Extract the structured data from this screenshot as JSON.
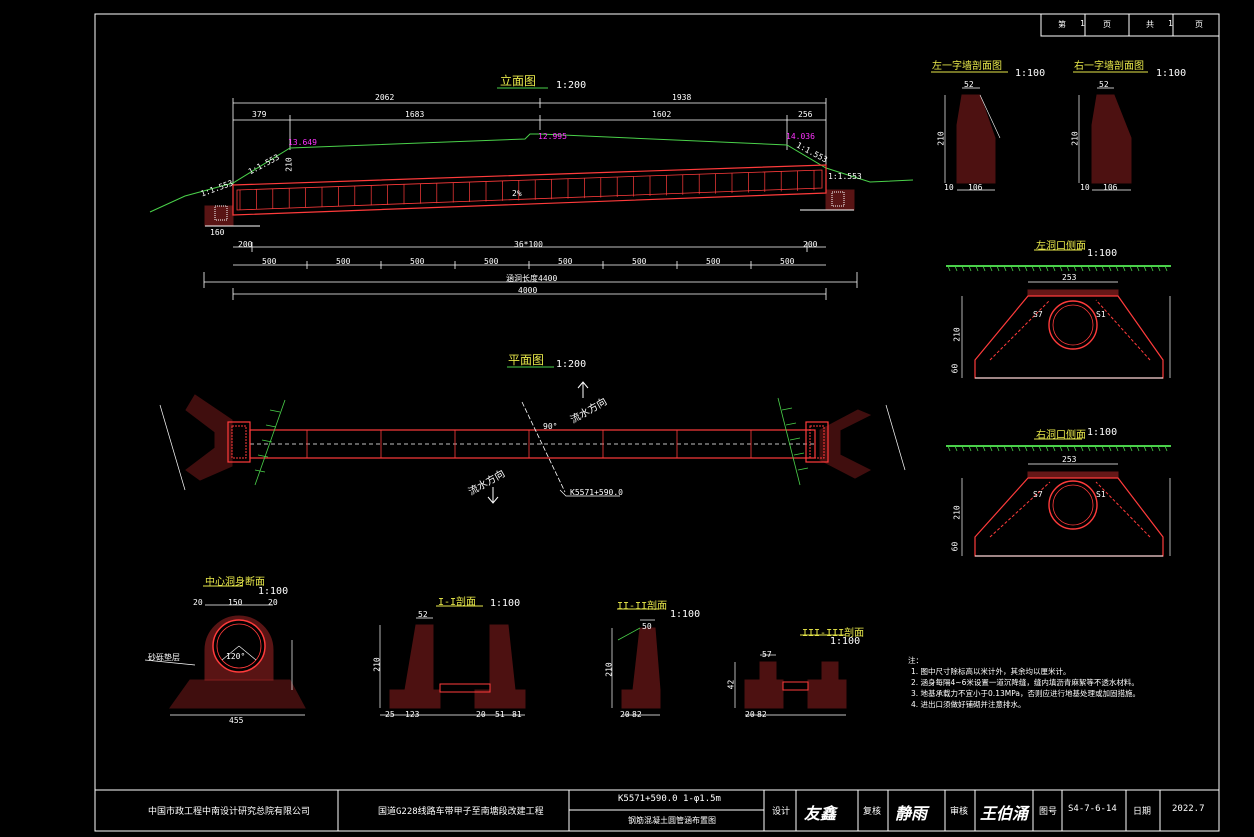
{
  "page": {
    "label_page": "第",
    "page_no": "1",
    "label_ye": "页",
    "label_total": "共",
    "total_no": "1",
    "label_ye2": "页"
  },
  "elevation": {
    "title": "立面图",
    "scale": "1:200",
    "dims_top": [
      "2062",
      "1938"
    ],
    "dims_mid": [
      "379",
      "1683",
      "1602",
      "256"
    ],
    "elev_left": "13.649",
    "elev_mid": "12.995",
    "elev_right": "14.036",
    "slope_left": "1:1.553",
    "slope_right": "1:1.553",
    "slope_left2": "1:1.553",
    "slope_right2": "1:1.553",
    "grade": "2%",
    "dims_bottom1": [
      "200",
      "36*100",
      "200"
    ],
    "dims_bottom2": [
      "500",
      "500",
      "500",
      "500",
      "500",
      "500",
      "500",
      "500"
    ],
    "total_label": "涵洞长度4400",
    "total": "4000",
    "label_210": "210",
    "label_160": "160"
  },
  "plan": {
    "title": "平面图",
    "scale": "1:200",
    "dir_up": "流水方向",
    "dir_down": "流水方向",
    "station": "K5571+590.0",
    "angle": "90°"
  },
  "left_wall": {
    "title": "左一字墙剖面图",
    "scale": "1:100",
    "d1": "52",
    "d2": "210",
    "d3": "106",
    "d4": "10"
  },
  "right_wall": {
    "title": "右一字墙剖面图",
    "scale": "1:100",
    "d1": "52",
    "d2": "210",
    "d3": "106",
    "d4": "10"
  },
  "left_portal": {
    "title": "左洞口侧面",
    "scale": "1:100",
    "d1": "253",
    "d2": "S7",
    "d3": "S1",
    "d4": "210",
    "d5": "60"
  },
  "right_portal": {
    "title": "右洞口侧面",
    "scale": "1:100",
    "d1": "253",
    "d2": "S7",
    "d3": "S1",
    "d4": "210",
    "d5": "60"
  },
  "center_section": {
    "title": "中心洞身断面",
    "scale": "1:100",
    "d1": "150",
    "d2": "20",
    "d3": "20",
    "d4": "120°",
    "d5": "455",
    "label_fill": "砂砾垫层"
  },
  "sec1": {
    "title": "I-I剖面",
    "scale": "1:100",
    "d1": "52",
    "d2": "210",
    "d3": "123",
    "d4": "25",
    "d5": "20",
    "d6": "51",
    "d7": "81"
  },
  "sec2": {
    "title": "II-II剖面",
    "scale": "1:100",
    "d1": "50",
    "d2": "210",
    "d3": "82",
    "d4": "20"
  },
  "sec3": {
    "title": "III-III剖面",
    "scale": "1:100",
    "d1": "57",
    "d2": "42",
    "d3": "82",
    "d4": "20"
  },
  "notes": {
    "title": "注：",
    "lines": [
      "1. 图中尺寸除标高以米计外，其余均以厘米计。",
      "2. 涵身每隔4~6米设置一道沉降缝，缝内填沥青麻絮等不透水材料。",
      "3. 地基承载力不宜小于0.13MPa，否则应进行地基处理或加固措施。",
      "4. 进出口须做好铺砌并注意排水。"
    ]
  },
  "title_block": {
    "org": "中国市政工程中南设计研究总院有限公司",
    "project": "国道G228线路车带甲子至南塘段改建工程",
    "drawing_top": "K5571+590.0  1-φ1.5m",
    "drawing_bottom": "钢筋混凝土圆管涵布置图",
    "label_design": "设计",
    "sig_design": "友鑫",
    "label_check": "复核",
    "sig_check": "静雨",
    "label_review": "审核",
    "sig_review": "王伯涌",
    "label_no": "图号",
    "drawing_no": "S4-7-6-14",
    "label_date": "日期",
    "date": "2022.7"
  }
}
